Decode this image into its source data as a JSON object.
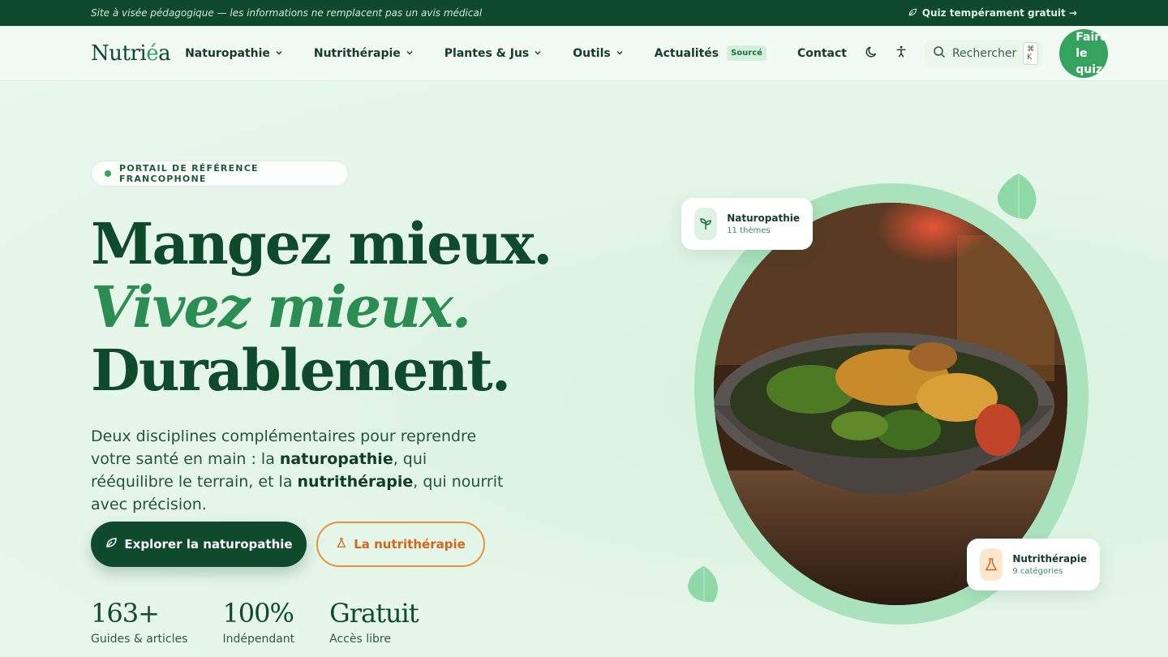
{
  "topbar": {
    "disclaimer": "Site à visée pédagogique — les informations ne remplacent pas un avis médical",
    "quiz_link": "Quiz tempérament gratuit →"
  },
  "header": {
    "logo_main": "Nutri",
    "logo_accent": "é",
    "logo_end": "a",
    "nav": [
      {
        "label": "Naturopathie",
        "icon": "chevron-down-icon"
      },
      {
        "label": "Nutrithérapie",
        "icon": "chevron-down-icon"
      },
      {
        "label": "Plantes & Jus",
        "icon": "chevron-down-icon"
      },
      {
        "label": "Outils",
        "icon": "chevron-down-icon"
      },
      {
        "label": "Actualités",
        "badge": "Sourcé"
      },
      {
        "label": "Contact"
      }
    ],
    "search_placeholder": "Rechercher",
    "search_shortcut": "⌘ K",
    "cta_label": "Faire le quiz"
  },
  "hero": {
    "pill": "PORTAIL DE RÉFÉRENCE FRANCOPHONE",
    "headline_1": "Mangez mieux.",
    "headline_2": "Vivez mieux.",
    "headline_3": "Durablement.",
    "lead_1": "Deux disciplines complémentaires pour reprendre votre santé en main : la ",
    "lead_bold_1": "naturopathie",
    "lead_2": ", qui rééquilibre le terrain, et la ",
    "lead_bold_2": "nutrithérapie",
    "lead_3": ", qui nourrit avec précision.",
    "primary_cta": "Explorer la naturopathie",
    "secondary_cta": "La nutrithérapie",
    "stats": [
      {
        "value": "163+",
        "label": "Guides & articles"
      },
      {
        "value": "100%",
        "label": "Indépendant"
      },
      {
        "value": "Gratuit",
        "label": "Accès libre"
      }
    ]
  },
  "cards": {
    "naturo_title": "Naturopathie",
    "naturo_sub": "11 thèmes",
    "nutri_title": "Nutrithérapie",
    "nutri_sub": "9 catégories"
  },
  "colors": {
    "brand_dark": "#0f4a2c",
    "brand_green": "#36a25f",
    "accent_orange": "#e8913f"
  }
}
